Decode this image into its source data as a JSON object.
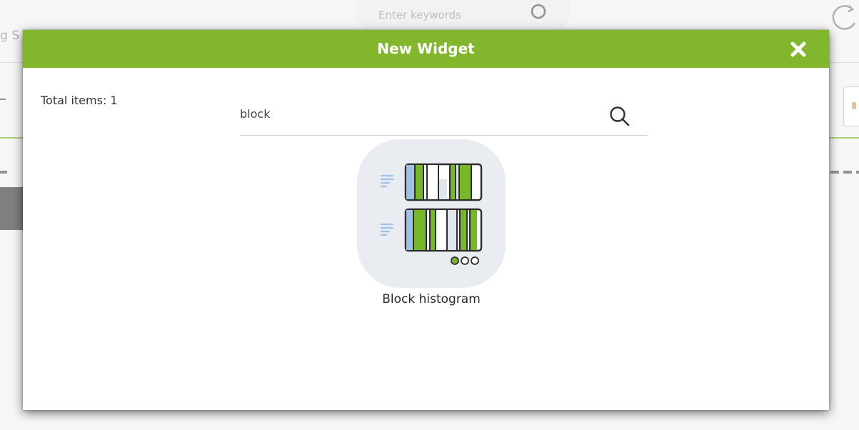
{
  "background": {
    "search_placeholder": "Enter keywords",
    "left_partial_text": "g S"
  },
  "modal": {
    "title": "New Widget",
    "total_items_text": "Total items: 1",
    "search": {
      "value": "block"
    },
    "items": [
      {
        "label": "Block histogram",
        "icon": "block-histogram-icon"
      }
    ]
  },
  "colors": {
    "header_green": "#82b72d",
    "icon_green": "#76b82a",
    "tile_bg": "#e9ecf1",
    "icon_blue": "#9fc3e7"
  }
}
